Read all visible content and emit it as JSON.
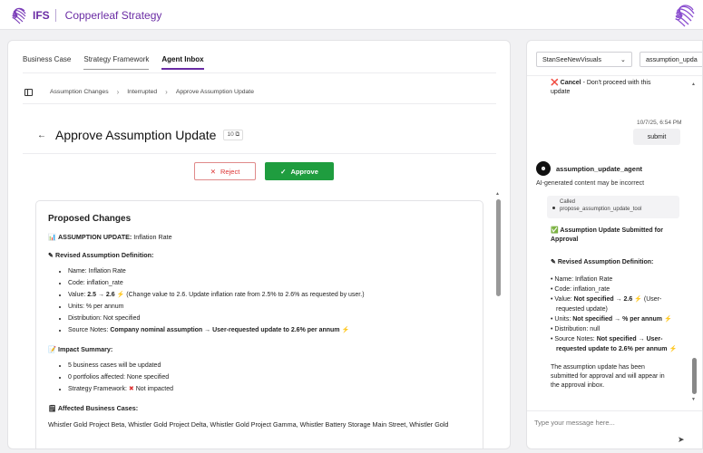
{
  "app": {
    "brand": "IFS",
    "product": "Copperleaf Strategy"
  },
  "tabs": [
    {
      "label": "Business Case"
    },
    {
      "label": "Strategy Framework"
    },
    {
      "label": "Agent Inbox"
    }
  ],
  "breadcrumbs": [
    "Assumption Changes",
    "Interrupted",
    "Approve Assumption Update"
  ],
  "page": {
    "title": "Approve Assumption Update",
    "id_badge": "10"
  },
  "actions": {
    "reject": "Reject",
    "approve": "Approve"
  },
  "proposed": {
    "heading": "Proposed Changes",
    "update_label": "ASSUMPTION UPDATE:",
    "update_value": "Inflation Rate",
    "revised_heading": "Revised Assumption Definition:",
    "name": "Name: Inflation Rate",
    "code": "Code: inflation_rate",
    "value_prefix": "Value: ",
    "value_bold": "2.5 → 2.6",
    "value_note": "(Change value to 2.6. Update inflation rate from 2.5% to 2.6% as requested by user.)",
    "units": "Units: % per annum",
    "distribution": "Distribution: Not specified",
    "source_prefix": "Source Notes: ",
    "source_bold": "Company nominal assumption → User-requested update to 2.6% per annum",
    "impact_heading": "Impact Summary:",
    "impact_1": "5 business cases will be updated",
    "impact_2": "0 portfolios affected: None specified",
    "impact_3_prefix": "Strategy Framework: ",
    "impact_3_suffix": "Not impacted",
    "affected_heading": "Affected Business Cases:",
    "affected_list": "Whistler Gold Project Beta, Whistler Gold Project Delta, Whistler Gold Project Gamma, Whistler Battery Storage Main Street, Whistler Gold"
  },
  "side": {
    "select_1": "StanSeeNewVisuals",
    "select_2": "assumption_upda",
    "cancel_label": "Cancel",
    "cancel_text": " - Don't proceed with this",
    "cancel_text_2": "update",
    "timestamp": "10/7/25, 6:54 PM",
    "user_message": "submit",
    "agent_name": "assumption_update_agent",
    "ai_note": "AI-generated content may be incorrect",
    "tool_called": "Called",
    "tool_name": "propose_assumption_update_tool",
    "submitted_title": "Assumption Update Submitted for",
    "submitted_title_2": "Approval",
    "revised_heading": "Revised Assumption Definition:",
    "b_name": "• Name: Inflation Rate",
    "b_code": "• Code: inflation_rate",
    "b_value_prefix": "• Value: ",
    "b_value_bold": "Not specified → 2.6",
    "b_value_suffix": " (User-",
    "b_value_suffix_2": "requested update)",
    "b_units_prefix": "• Units: ",
    "b_units_bold": "Not specified → % per annum",
    "b_distribution": "• Distribution: null",
    "b_source_prefix": "• Source Notes: ",
    "b_source_bold": "Not specified →",
    "b_source_bold_2": "User-",
    "b_source_bold_3": "requested update to 2.6% per annum",
    "final_1": "The assumption update has been",
    "final_2": "submitted for approval and will appear in",
    "final_3": "the approval inbox.",
    "input_placeholder": "Type your message here..."
  }
}
